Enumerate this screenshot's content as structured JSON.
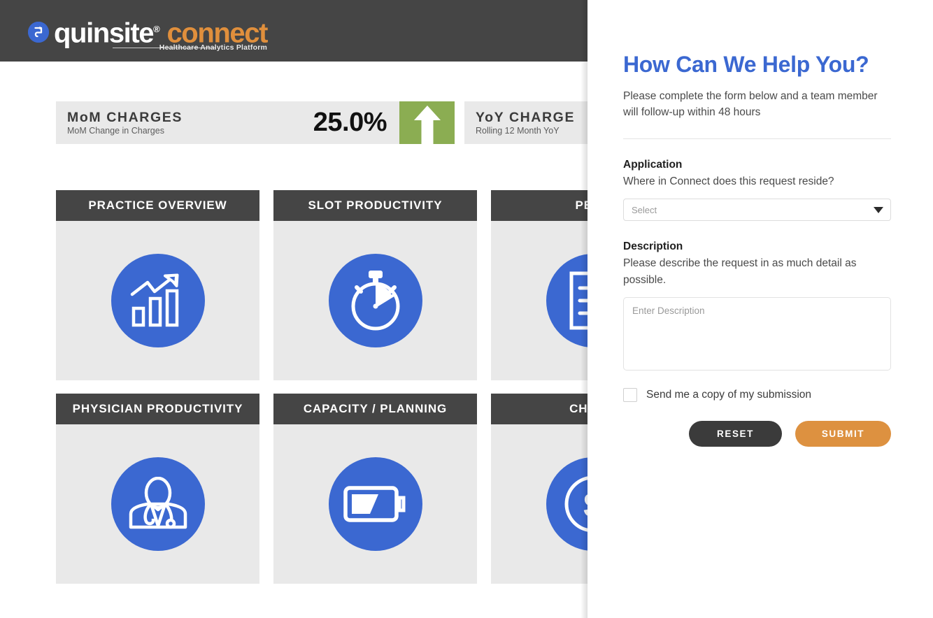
{
  "header": {
    "logo_mark_icon": "quinsite-5-arrow-icon",
    "brand_primary": "quinsite",
    "brand_tm": "®",
    "brand_secondary": "connect",
    "tagline": "Healthcare Analytics Platform",
    "background_color": "#454545"
  },
  "kpis": [
    {
      "title": "MoM CHARGES",
      "subtitle": "MoM Change in Charges",
      "value": "25.0%",
      "trend_icon": "up-arrow-icon",
      "trend_color": "#8bad52"
    },
    {
      "title": "YoY CHARGE",
      "subtitle": "Rolling 12 Month YoY",
      "value": "",
      "trend_icon": "",
      "trend_color": ""
    }
  ],
  "tiles": [
    [
      {
        "label": "PRACTICE OVERVIEW",
        "icon": "growth-chart-icon"
      },
      {
        "label": "SLOT PRODUCTIVITY",
        "icon": "stopwatch-icon"
      },
      {
        "label": "PEER ",
        "icon": "report-document-icon"
      }
    ],
    [
      {
        "label": "PHYSICIAN PRODUCTIVITY",
        "icon": "physician-icon"
      },
      {
        "label": "CAPACITY / PLANNING",
        "icon": "battery-icon"
      },
      {
        "label": "CHARG",
        "icon": "dollar-circle-icon"
      }
    ]
  ],
  "panel": {
    "title": "How Can We Help You?",
    "description": "Please complete the form below and a team member will follow-up within 48 hours",
    "application": {
      "label": "Application",
      "help": "Where in Connect does this request reside?",
      "select_value": "Select",
      "dropdown_icon": "chevron-down-icon"
    },
    "description_field": {
      "label": "Description",
      "help": "Please describe the request in as much detail as possible.",
      "placeholder": "Enter Description"
    },
    "copy_checkbox_label": "Send me a copy of my submission",
    "reset_label": "RESET",
    "submit_label": "SUBMIT",
    "accent_color": "#3b68d1",
    "submit_color": "#dd9140"
  }
}
